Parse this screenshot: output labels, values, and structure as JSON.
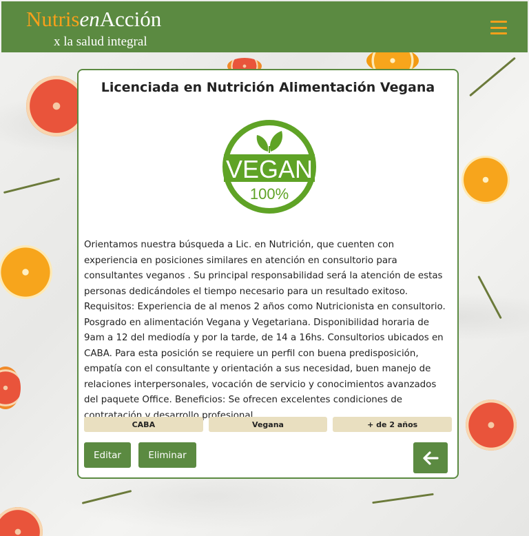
{
  "header": {
    "brand_part1": "Nutris",
    "brand_part2": "en",
    "brand_part3": "Acción",
    "tagline": "x la salud integral",
    "menu_icon": "hamburger-menu-icon",
    "brand_color": "#f7a01b",
    "background_color": "#5b8a41"
  },
  "card": {
    "title": "Licenciada en Nutrición Alimentación Vegana",
    "logo": {
      "word": "VEGAN",
      "percent": "100%",
      "icon": "leaf-icon",
      "color": "#5fa326"
    },
    "description": "Orientamos nuestra búsqueda a Lic. en Nutrición, que cuenten con experiencia en posiciones similares en atención en consultorio para consultantes veganos . Su principal responsabilidad será la atención de estas personas dedicándoles el tiempo necesario para un resultado exitoso. Requisitos: Experiencia de al menos 2 años como Nutricionista en consultorio. Posgrado en alimentación Vegana y Vegetariana. Disponibilidad horaria de 9am a 12 del mediodía y por la tarde, de 14 a 16hs. Consultorios ubicados en CABA. Para esta posición se requiere un perfil con buena predisposición, empatía con el consultante y orientación a sus necesidad, buen manejo de relaciones interpersonales, vocación de servicio y conocimientos avanzados del paquete Office. Beneficios: Se ofrecen excelentes condiciones de contratación y desarrollo profesional.",
    "tags": [
      "CABA",
      "Vegana",
      "+ de 2 años"
    ],
    "edit_label": "Editar",
    "delete_label": "Eliminar",
    "back_icon": "arrow-left-icon",
    "tag_color": "#e9dfc0"
  }
}
